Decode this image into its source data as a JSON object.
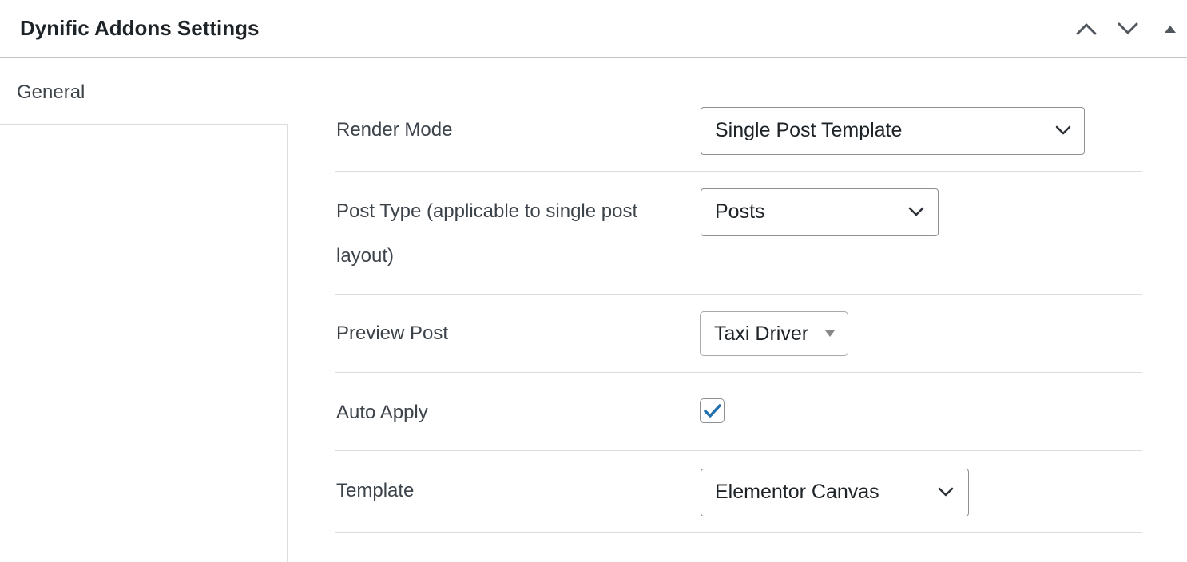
{
  "metabox": {
    "title": "Dynific Addons Settings"
  },
  "header_controls": {
    "move_up_icon": "chevron-up-icon",
    "move_down_icon": "chevron-down-icon",
    "toggle_icon": "triangle-up-icon"
  },
  "tabs": [
    {
      "label": "General",
      "active": true
    }
  ],
  "fields": {
    "render_mode": {
      "label": "Render Mode",
      "value": "Single Post Template"
    },
    "post_type": {
      "label_line1": "Post Type (applicable to single post",
      "label_line2": "layout)",
      "value": "Posts"
    },
    "preview_post": {
      "label": "Preview Post",
      "value": "Taxi Driver"
    },
    "auto_apply": {
      "label": "Auto Apply",
      "checked": true
    },
    "template": {
      "label": "Template",
      "value": "Elementor Canvas"
    }
  },
  "colors": {
    "checkmark": "#2271b1",
    "border": "#8c8f94",
    "divider": "#dcdcde",
    "label_text": "#3c434a"
  }
}
